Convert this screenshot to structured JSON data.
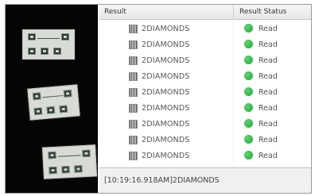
{
  "window": {
    "columns": {
      "result": "Result",
      "status": "Result Status"
    }
  },
  "rows": [
    {
      "result": "2DIAMONDS",
      "status": "Read",
      "status_color": "#22a63b",
      "icon": "barcode-icon"
    },
    {
      "result": "2DIAMONDS",
      "status": "Read",
      "status_color": "#22a63b",
      "icon": "barcode-icon"
    },
    {
      "result": "2DIAMONDS",
      "status": "Read",
      "status_color": "#22a63b",
      "icon": "barcode-icon"
    },
    {
      "result": "2DIAMONDS",
      "status": "Read",
      "status_color": "#22a63b",
      "icon": "barcode-icon"
    },
    {
      "result": "2DIAMONDS",
      "status": "Read",
      "status_color": "#22a63b",
      "icon": "barcode-icon"
    },
    {
      "result": "2DIAMONDS",
      "status": "Read",
      "status_color": "#22a63b",
      "icon": "barcode-icon"
    },
    {
      "result": "2DIAMONDS",
      "status": "Read",
      "status_color": "#22a63b",
      "icon": "barcode-icon"
    },
    {
      "result": "2DIAMONDS",
      "status": "Read",
      "status_color": "#22a63b",
      "icon": "barcode-icon"
    },
    {
      "result": "2DIAMONDS",
      "status": "Read",
      "status_color": "#22a63b",
      "icon": "barcode-icon"
    }
  ],
  "log": {
    "text": "[10:19:16.918AM]2DIAMONDS"
  }
}
